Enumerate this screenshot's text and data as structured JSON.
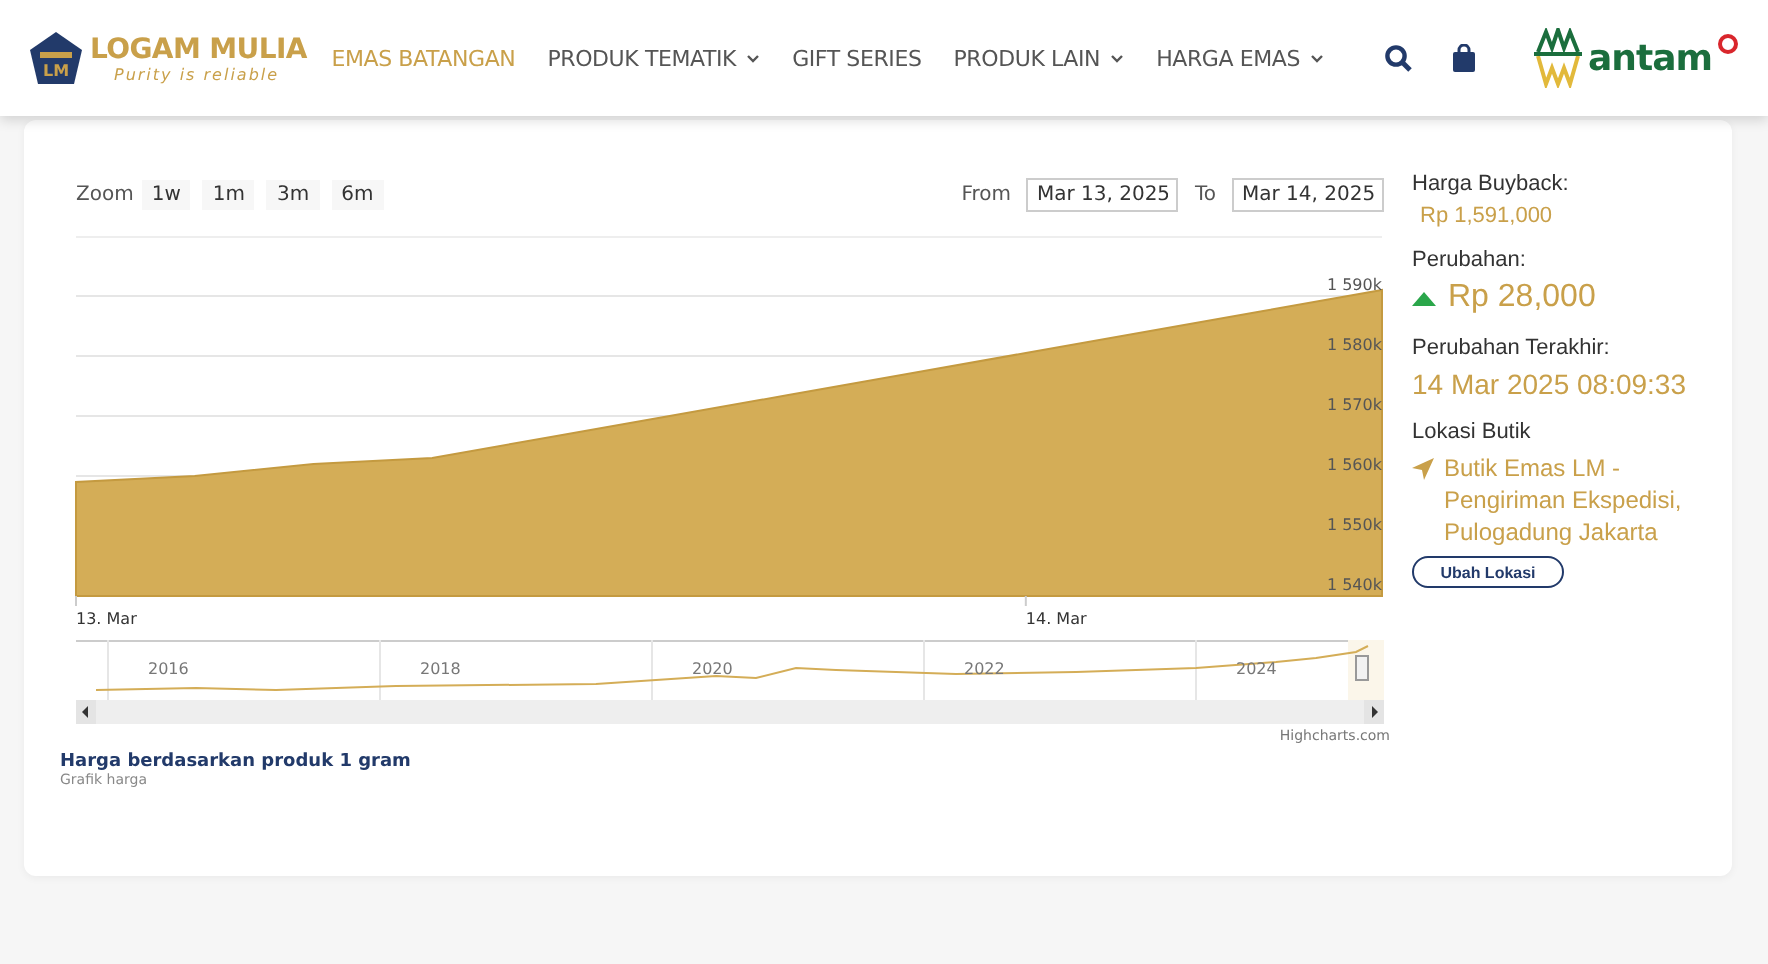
{
  "brand": {
    "name": "LOGAM MULIA",
    "tagline": "Purity is reliable",
    "badge": "LM"
  },
  "nav": [
    {
      "label": "EMAS BATANGAN",
      "selected": true,
      "dropdown": false
    },
    {
      "label": "PRODUK TEMATIK",
      "selected": false,
      "dropdown": true
    },
    {
      "label": "GIFT SERIES",
      "selected": false,
      "dropdown": false
    },
    {
      "label": "PRODUK LAIN",
      "selected": false,
      "dropdown": true
    },
    {
      "label": "HARGA EMAS",
      "selected": false,
      "dropdown": true
    }
  ],
  "partner_logo": "antam",
  "range_selector": {
    "zoom_label": "Zoom",
    "buttons": [
      {
        "label": "1w",
        "selected": false
      },
      {
        "label": "1m",
        "selected": false
      },
      {
        "label": "3m",
        "selected": false
      },
      {
        "label": "6m",
        "selected": false
      }
    ],
    "from_label": "From",
    "from_value": "Mar 13, 2025",
    "to_label": "To",
    "to_value": "Mar 14, 2025"
  },
  "chart_data": {
    "type": "area",
    "categories": [
      "13. Mar",
      null,
      null,
      null,
      null,
      null,
      null,
      null,
      "14. Mar",
      null,
      null,
      null
    ],
    "series": [
      {
        "color": "#d4ad57",
        "values": [
          1559000,
          1560000,
          1562000,
          1563000,
          1566500,
          1570000,
          1573500,
          1577000,
          1580500,
          1584000,
          1587500,
          1591000
        ]
      }
    ],
    "ylim": [
      1540000,
      1600000
    ],
    "grid": true,
    "yticks": [
      {
        "value": 1540000,
        "label": "1 540k"
      },
      {
        "value": 1550000,
        "label": "1 550k"
      },
      {
        "value": 1560000,
        "label": "1 560k"
      },
      {
        "value": 1570000,
        "label": "1 570k"
      },
      {
        "value": 1580000,
        "label": "1 580k"
      },
      {
        "value": 1590000,
        "label": "1 590k"
      }
    ]
  },
  "navigator": {
    "years": [
      "2016",
      "2018",
      "2020",
      "2022",
      "2024"
    ]
  },
  "credits": "Highcharts.com",
  "caption": {
    "title": "Harga berdasarkan produk 1 gram",
    "subtitle": "Grafik harga"
  },
  "info": {
    "buyback_label": "Harga Buyback:",
    "buyback_value": "Rp 1,591,000",
    "change_label": "Perubahan:",
    "change_up": true,
    "change_value": "Rp 28,000",
    "last_change_label": "Perubahan Terakhir:",
    "last_change_value": "14 Mar 2025 08:09:33",
    "location_label": "Lokasi Butik",
    "location_value": "Butik Emas LM - Pengiriman Ekspedisi, Pulogadung Jakarta",
    "location_button": "Ubah Lokasi"
  }
}
